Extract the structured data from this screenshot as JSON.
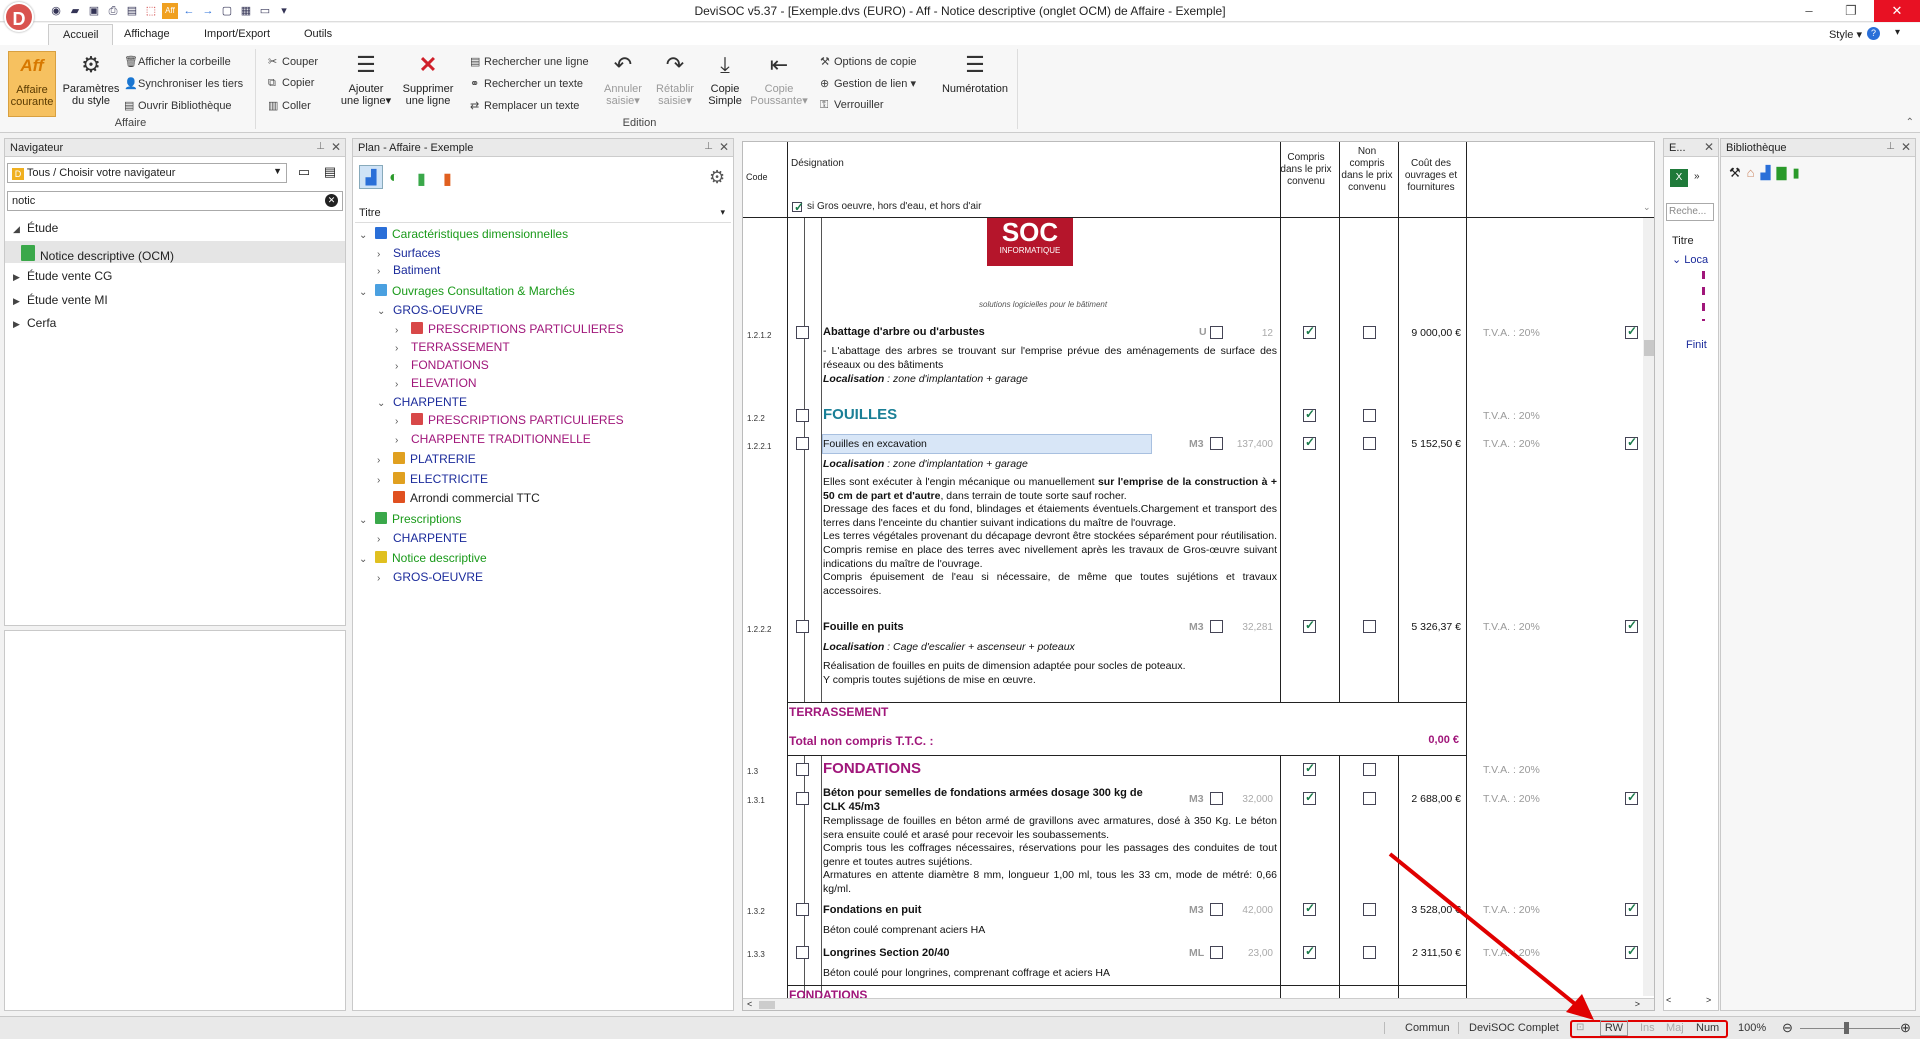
{
  "window": {
    "title": "DeviSOC v5.37 - [Exemple.dvs (EURO) - Aff - Notice descriptive (onglet OCM) de Affaire - Exemple]",
    "style_label": "Style"
  },
  "app_logo": "D",
  "tabs": [
    "Accueil",
    "Affichage",
    "Import/Export",
    "Outils"
  ],
  "ribbon": {
    "affaire": {
      "label": "Affaire",
      "aff_icon": "Aff",
      "affaire_courante": [
        "Affaire",
        "courante"
      ],
      "parametres": [
        "Paramètres",
        "du style"
      ],
      "corbeille": "Afficher la corbeille",
      "synchro": "Synchroniser les tiers",
      "biblio": "Ouvrir Bibliothèque"
    },
    "edition": {
      "label": "Edition",
      "couper": "Couper",
      "copier": "Copier",
      "coller": "Coller",
      "ajouter": [
        "Ajouter",
        "une ligne"
      ],
      "supprimer": [
        "Supprimer",
        "une ligne"
      ],
      "rechercher_ligne": "Rechercher une ligne",
      "rechercher_texte": "Rechercher un texte",
      "remplacer": "Remplacer un texte",
      "annuler": [
        "Annuler",
        "saisie"
      ],
      "retablir": [
        "Rétablir",
        "saisie"
      ],
      "copie_simple": [
        "Copie",
        "Simple"
      ],
      "copie_poussante": [
        "Copie",
        "Poussante"
      ],
      "options_copie": "Options de copie",
      "gestion_lien": "Gestion de lien",
      "verrouiller": "Verrouiller",
      "numerotation": "Numérotation"
    }
  },
  "navigator": {
    "title": "Navigateur",
    "select": "Tous / Choisir votre navigateur",
    "search": "notic",
    "items": [
      {
        "label": "Étude",
        "expanded": true
      },
      {
        "label": "Notice descriptive (OCM)",
        "child": true
      },
      {
        "label": "Étude vente CG"
      },
      {
        "label": "Étude vente MI"
      },
      {
        "label": "Cerfa"
      }
    ]
  },
  "plan": {
    "title": "Plan - Affaire - Exemple",
    "column": "Titre",
    "rows": [
      {
        "level": 0,
        "exp": "v",
        "icon": "list",
        "label": "Caractéristiques dimensionnelles",
        "color": "green"
      },
      {
        "level": 1,
        "exp": ">",
        "label": "Surfaces",
        "color": "blue"
      },
      {
        "level": 1,
        "exp": ">",
        "label": "Batiment",
        "color": "blue"
      },
      {
        "level": 0,
        "exp": "v",
        "icon": "doc",
        "label": "Ouvrages Consultation & Marchés",
        "color": "green"
      },
      {
        "level": 1,
        "exp": "v",
        "label": "GROS-OEUVRE",
        "color": "blue"
      },
      {
        "level": 2,
        "exp": ">",
        "icon": "presc",
        "label": "PRESCRIPTIONS  PARTICULIERES",
        "color": "purple"
      },
      {
        "level": 2,
        "exp": ">",
        "label": "TERRASSEMENT",
        "color": "purple"
      },
      {
        "level": 2,
        "exp": ">",
        "label": "FONDATIONS",
        "color": "purple"
      },
      {
        "level": 2,
        "exp": ">",
        "label": "ELEVATION",
        "color": "purple"
      },
      {
        "level": 1,
        "exp": "v",
        "label": "CHARPENTE",
        "color": "blue"
      },
      {
        "level": 2,
        "exp": ">",
        "icon": "presc",
        "label": "PRESCRIPTIONS  PARTICULIERES",
        "color": "purple"
      },
      {
        "level": 2,
        "exp": ">",
        "label": "CHARPENTE TRADITIONNELLE",
        "color": "purple"
      },
      {
        "level": 1,
        "exp": ">",
        "icon": "lock",
        "label": "PLATRERIE",
        "color": "blue"
      },
      {
        "level": 1,
        "exp": ">",
        "icon": "lock",
        "label": "ELECTRICITE",
        "color": "blue"
      },
      {
        "level": 1,
        "exp": "",
        "icon": "gift",
        "label": "Arrondi commercial TTC",
        "color": "dark"
      },
      {
        "level": 0,
        "exp": "v",
        "icon": "green",
        "label": "Prescriptions",
        "color": "green"
      },
      {
        "level": 1,
        "exp": ">",
        "label": "CHARPENTE",
        "color": "blue"
      },
      {
        "level": 0,
        "exp": "v",
        "icon": "yellow",
        "label": "Notice descriptive",
        "color": "green"
      },
      {
        "level": 1,
        "exp": ">",
        "label": "GROS-OEUVRE",
        "color": "blue"
      }
    ]
  },
  "document": {
    "headers": {
      "code": "Code",
      "designation": "Désignation",
      "filter": "si Gros oeuvre, hors d'eau, et hors d'air",
      "compris": "Compris dans le prix convenu",
      "non_compris": "Non compris dans le prix convenu",
      "cout": "Coût des ouvrages et fournitures"
    },
    "logo": {
      "text": "SOC",
      "sub": "INFORMATIQUE",
      "tagline": "solutions logicielles pour le bâtiment"
    },
    "items": {
      "abattage": {
        "code": "1.2.1.2",
        "title": "Abattage d'arbre ou d'arbustes",
        "unit": "U",
        "qty": "12",
        "price": "9 000,00 €",
        "tva": "T.V.A. : 20%",
        "desc": "- L'abattage des arbres se trouvant sur l'emprise prévue des aménagements de surface des réseaux ou des bâtiments",
        "loc_label": "Localisation",
        "loc": " : zone d'implantation + garage"
      },
      "fouilles": {
        "code": "1.2.2",
        "title": "FOUILLES",
        "tva": "T.V.A. : 20%"
      },
      "excavation": {
        "code": "1.2.2.1",
        "title": "Fouilles en excavation",
        "unit": "M3",
        "qty": "137,400",
        "price": "5 152,50 €",
        "tva": "T.V.A. : 20%",
        "loc_label": "Localisation",
        "loc": " : zone d'implantation + garage",
        "d1": "Elles sont exécuter à l'engin mécanique ou manuellement ",
        "d1b": "sur l'emprise de la construction à + 50 cm de part et d'autre",
        "d1c": ", dans terrain de toute sorte sauf rocher.",
        "d2": "Dressage des faces et du fond, blindages et étaiements éventuels.Chargement et transport des terres dans l'enceinte du chantier suivant indications du maître de l'ouvrage.",
        "d3": "Les terres végétales provenant du décapage devront être stockées séparément pour réutilisation. Compris remise en place des terres avec nivellement après les travaux de Gros-œuvre suivant indications du maître de l'ouvrage.",
        "d4": "Compris épuisement de l'eau si nécessaire, de même que toutes sujétions et travaux accessoires."
      },
      "puits": {
        "code": "1.2.2.2",
        "title": "Fouille en puits",
        "unit": "M3",
        "qty": "32,281",
        "price": "5 326,37 €",
        "tva": "T.V.A. : 20%",
        "loc_label": "Localisation",
        "loc": " : Cage d'escalier + ascenseur + poteaux",
        "d1": "Réalisation de fouilles en puits de dimension adaptée pour socles de poteaux.",
        "d2": "Y compris toutes sujétions de mise en œuvre."
      },
      "terrassement": {
        "label": "TERRASSEMENT",
        "total_label": "Total non compris T.T.C. :",
        "total": "0,00 €"
      },
      "fondations": {
        "code": "1.3",
        "title": "FONDATIONS",
        "tva": "T.V.A. : 20%"
      },
      "beton": {
        "code": "1.3.1",
        "title": "Béton pour semelles de fondations armées  dosage 300 kg de CLK 45/m3",
        "unit": "M3",
        "qty": "32,000",
        "price": "2 688,00 €",
        "tva": "T.V.A. : 20%",
        "d1": "Remplissage de fouilles en béton armé de gravillons avec armatures, dosé à 350 Kg. Le béton sera ensuite coulé et arasé pour recevoir les soubassements.",
        "d2": "Compris tous les coffrages nécessaires, réservations pour les passages des conduites de tout genre et toutes autres sujétions.",
        "d3": "Armatures en attente diamètre 8 mm, longueur 1,00 ml, tous les 33 cm, mode de métré: 0,66 kg/ml."
      },
      "fond_puit": {
        "code": "1.3.2",
        "title": "Fondations en puit",
        "unit": "M3",
        "qty": "42,000",
        "price": "3 528,00 €",
        "tva": "T.V.A. : 20%",
        "d1": "Béton coulé comprenant aciers HA"
      },
      "longrines": {
        "code": "1.3.3",
        "title": "Longrines Section 20/40",
        "unit": "ML",
        "qty": "23,00",
        "price": "2 311,50 €",
        "tva": "T.V.A. : 20%",
        "d1": "Béton coulé pour longrines, comprenant coffrage et aciers HA"
      },
      "fondations_footer": "FONDATIONS"
    }
  },
  "right_panels": {
    "e_title": "E...",
    "search_placeholder": "Reche...",
    "col": "Titre",
    "loc": "Loca",
    "fini": "Finit",
    "biblio_title": "Bibliothèque"
  },
  "status": {
    "commun": "Commun",
    "edition": "DeviSOC Complet",
    "rw": "RW",
    "ins": "Ins",
    "maj": "Maj",
    "num": "Num",
    "zoom": "100%"
  },
  "colors": {
    "accent": "#1a9a1a",
    "purple": "#a0167a",
    "highlight_red": "#e00000"
  }
}
